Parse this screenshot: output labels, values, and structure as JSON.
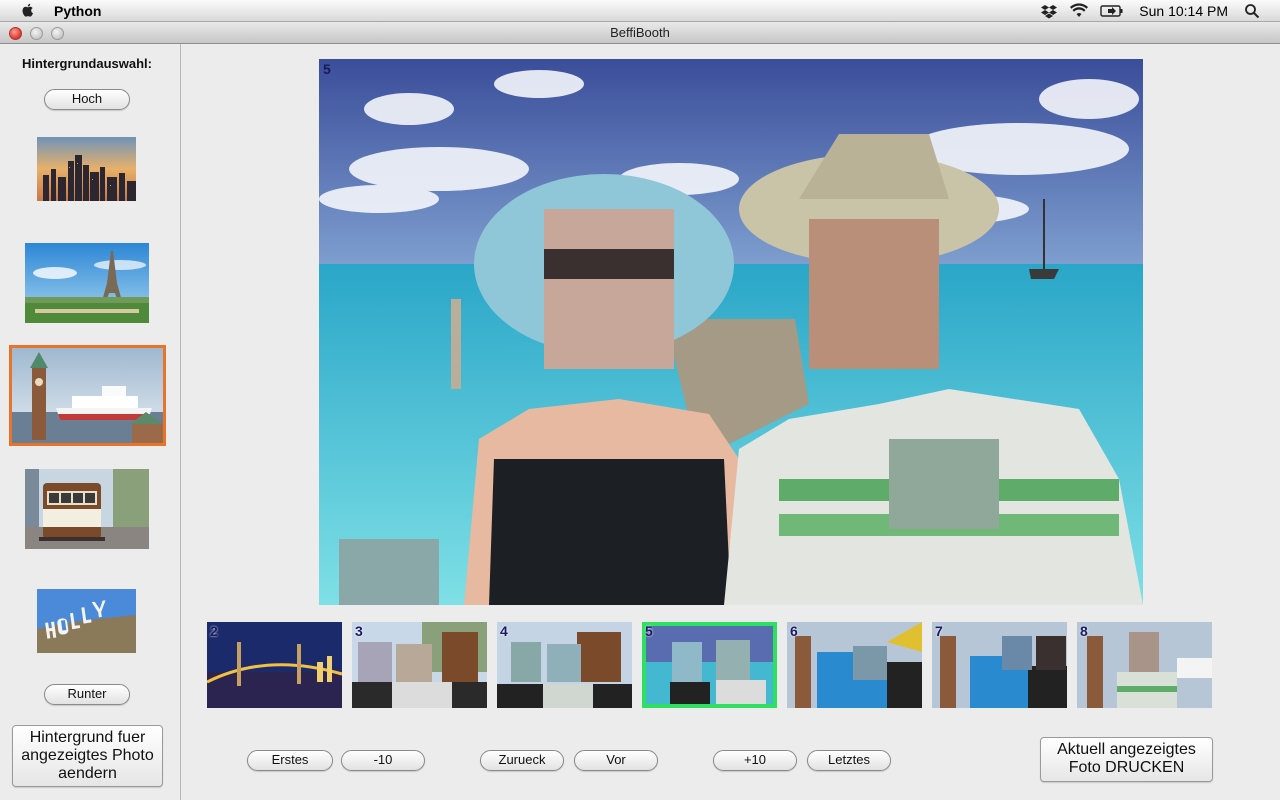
{
  "menubar": {
    "app_name": "Python",
    "clock": "Sun 10:14 PM",
    "icons": [
      "apple-icon",
      "dropbox-icon",
      "wifi-icon",
      "battery-icon",
      "spotlight-icon"
    ]
  },
  "window": {
    "title": "BeffiBooth"
  },
  "sidebar": {
    "title": "Hintergrundauswahl:",
    "up_button": "Hoch",
    "down_button": "Runter",
    "change_button": "Hintergrund fuer angezeigtes Photo aendern",
    "backgrounds": [
      {
        "name": "city-skyline",
        "selected": false
      },
      {
        "name": "eiffel-tower",
        "selected": false
      },
      {
        "name": "hamburg-harbor",
        "selected": true
      },
      {
        "name": "cable-car",
        "selected": false
      },
      {
        "name": "hollywood-sign",
        "selected": false
      }
    ]
  },
  "main_photo": {
    "number": "5"
  },
  "filmstrip": {
    "items": [
      {
        "number": "2",
        "selected": false
      },
      {
        "number": "3",
        "selected": false
      },
      {
        "number": "4",
        "selected": false
      },
      {
        "number": "5",
        "selected": true
      },
      {
        "number": "6",
        "selected": false
      },
      {
        "number": "7",
        "selected": false
      },
      {
        "number": "8",
        "selected": false
      }
    ]
  },
  "navigation": {
    "first": "Erstes",
    "minus10": "-10",
    "back": "Zurueck",
    "forward": "Vor",
    "plus10": "+10",
    "last": "Letztes",
    "print": "Aktuell angezeigtes Foto DRUCKEN"
  },
  "colors": {
    "selected_background_border": "#e8732a",
    "selected_strip_border": "#2ee05f"
  }
}
